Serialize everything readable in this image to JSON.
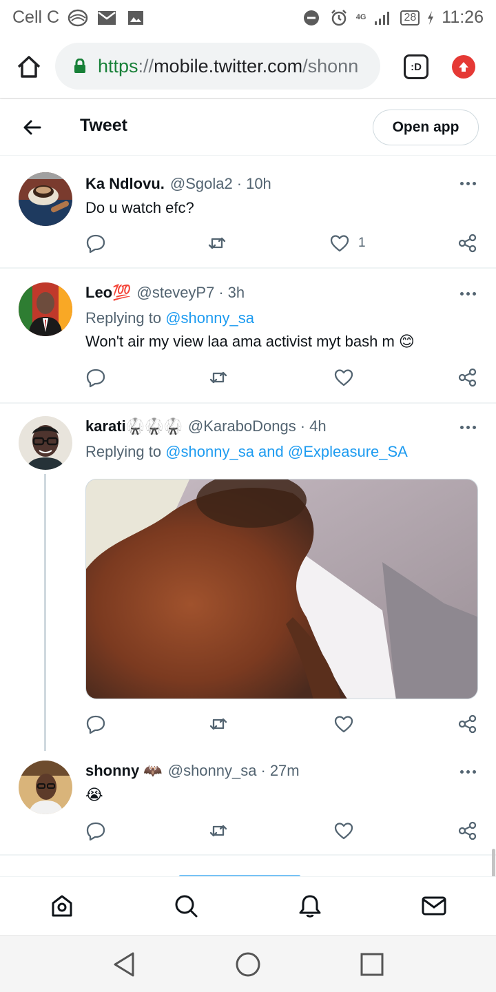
{
  "status_bar": {
    "carrier": "Cell C",
    "network": "4G",
    "battery": "28",
    "time": "11:26"
  },
  "browser": {
    "url_scheme": "https",
    "url_sep": "://",
    "url_host": "mobile.twitter.com",
    "url_path": "/shonn",
    "tabs_label": ":D"
  },
  "header": {
    "title": "Tweet",
    "open_app": "Open app"
  },
  "tweets": [
    {
      "name": "Ka Ndlovu.",
      "handle": "@Sgola2",
      "dot": "·",
      "time": "10h",
      "text": "Do u watch efc?",
      "likes": "1"
    },
    {
      "name": "Leo💯",
      "handle": "@steveyP7",
      "dot": "·",
      "time": "3h",
      "reply_prefix": "Replying to ",
      "reply_mention": "@shonny_sa",
      "text": "Won't air my view laa ama activist myt bash m 😊"
    },
    {
      "name": "karati🥋🥋🥋",
      "handle": "@KaraboDongs",
      "dot": "·",
      "time": "4h",
      "reply_prefix": "Replying to ",
      "reply_mention": "@shonny_sa and @Expleasure_SA"
    },
    {
      "name": "shonny 🦇",
      "handle": "@shonny_sa",
      "dot": "·",
      "time": "27m",
      "text": "😭"
    }
  ],
  "colors": {
    "accent": "#1d9bf0",
    "text": "#0f1419",
    "secondary": "#536471"
  }
}
